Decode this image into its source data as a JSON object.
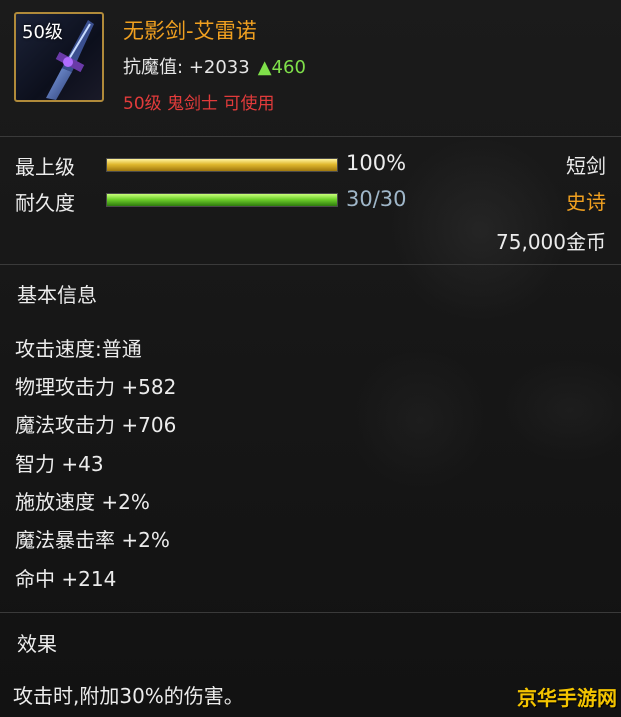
{
  "item": {
    "level_badge": "50级",
    "name": "无影剑-艾雷诺",
    "stat_label": "抗魔值:",
    "stat_value": "+2033",
    "stat_increase": "▲460",
    "requirement": "50级 鬼剑士 可使用",
    "icon": "sword-icon"
  },
  "upgrade": {
    "label": "最上级",
    "value_text": "100%",
    "fill_fraction": 1.0
  },
  "durability": {
    "label": "耐久度",
    "value_text": "30/30",
    "fill_fraction": 1.0
  },
  "weapon_type": "短剑",
  "rarity": "史诗",
  "price": "75,000金币",
  "basic_info": {
    "header": "基本信息",
    "attributes": [
      "攻击速度:普通",
      "物理攻击力 +582",
      "魔法攻击力 +706",
      "智力 +43",
      "施放速度 +2%",
      "魔法暴击率 +2%",
      "命中 +214"
    ]
  },
  "effect": {
    "header": "效果",
    "text": "攻击时,附加30%的伤害。"
  },
  "watermark": "京华手游网",
  "colors": {
    "title": "#f0a020",
    "requirement": "#e23b3b",
    "increase": "#7fe04a",
    "rarity": "#f0a020",
    "durability_value": "#9fb6c8",
    "watermark": "#f4c400"
  }
}
